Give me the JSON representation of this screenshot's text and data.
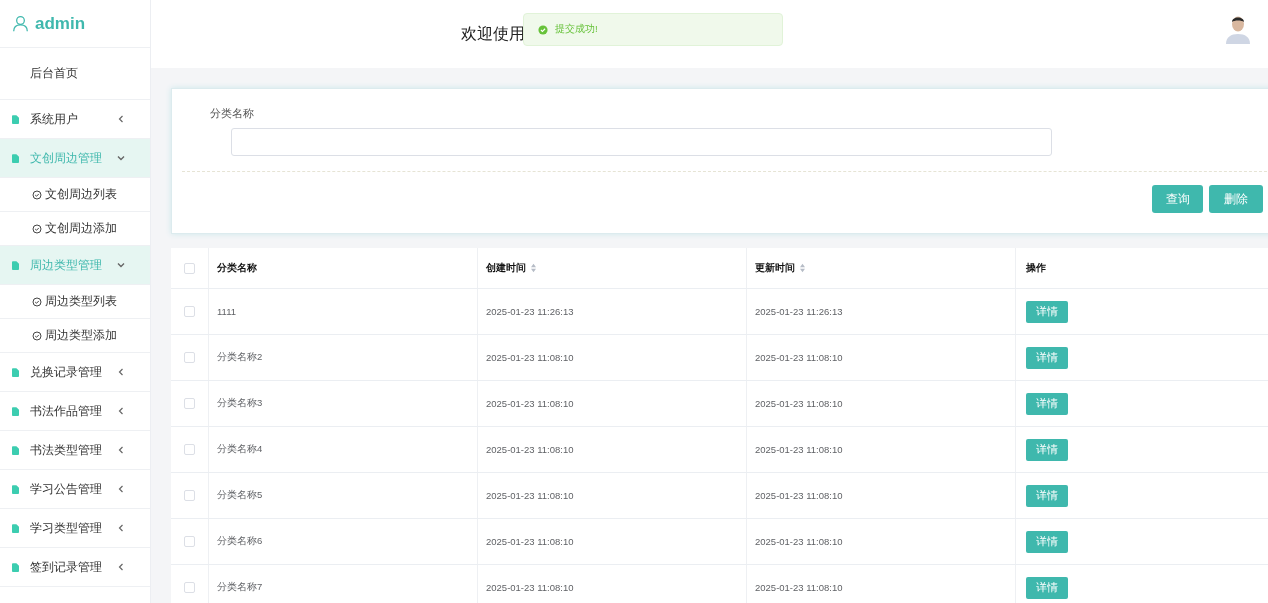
{
  "sidebar": {
    "user": "admin",
    "home": "后台首页",
    "groups": [
      {
        "label": "系统用户",
        "expanded": false
      },
      {
        "label": "文创周边管理",
        "expanded": true,
        "children": [
          {
            "label": "文创周边列表"
          },
          {
            "label": "文创周边添加"
          }
        ]
      },
      {
        "label": "周边类型管理",
        "expanded": true,
        "children": [
          {
            "label": "周边类型列表"
          },
          {
            "label": "周边类型添加"
          }
        ]
      },
      {
        "label": "兑换记录管理",
        "expanded": false
      },
      {
        "label": "书法作品管理",
        "expanded": false
      },
      {
        "label": "书法类型管理",
        "expanded": false
      },
      {
        "label": "学习公告管理",
        "expanded": false
      },
      {
        "label": "学习类型管理",
        "expanded": false
      },
      {
        "label": "签到记录管理",
        "expanded": false
      }
    ]
  },
  "header": {
    "welcome": "欢迎使用",
    "toast": "提交成功!"
  },
  "search": {
    "label": "分类名称",
    "buttons": [
      "查询",
      "删除"
    ]
  },
  "table": {
    "all_checked": false,
    "columns": [
      {
        "label": "分类名称",
        "sortable": false
      },
      {
        "label": "创建时间",
        "sortable": true
      },
      {
        "label": "更新时间",
        "sortable": true
      },
      {
        "label": "操作",
        "sortable": false
      }
    ],
    "rows": [
      {
        "cells": [
          "1111",
          "2025-01-23 11:26:13",
          "2025-01-23 11:26:13"
        ],
        "action": "详情",
        "checked": false
      },
      {
        "cells": [
          "分类名称2",
          "2025-01-23 11:08:10",
          "2025-01-23 11:08:10"
        ],
        "action": "详情",
        "checked": false
      },
      {
        "cells": [
          "分类名称3",
          "2025-01-23 11:08:10",
          "2025-01-23 11:08:10"
        ],
        "action": "详情",
        "checked": false
      },
      {
        "cells": [
          "分类名称4",
          "2025-01-23 11:08:10",
          "2025-01-23 11:08:10"
        ],
        "action": "详情",
        "checked": false
      },
      {
        "cells": [
          "分类名称5",
          "2025-01-23 11:08:10",
          "2025-01-23 11:08:10"
        ],
        "action": "详情",
        "checked": false
      },
      {
        "cells": [
          "分类名称6",
          "2025-01-23 11:08:10",
          "2025-01-23 11:08:10"
        ],
        "action": "详情",
        "checked": false
      },
      {
        "cells": [
          "分类名称7",
          "2025-01-23 11:08:10",
          "2025-01-23 11:08:10"
        ],
        "action": "详情",
        "checked": false
      }
    ]
  }
}
